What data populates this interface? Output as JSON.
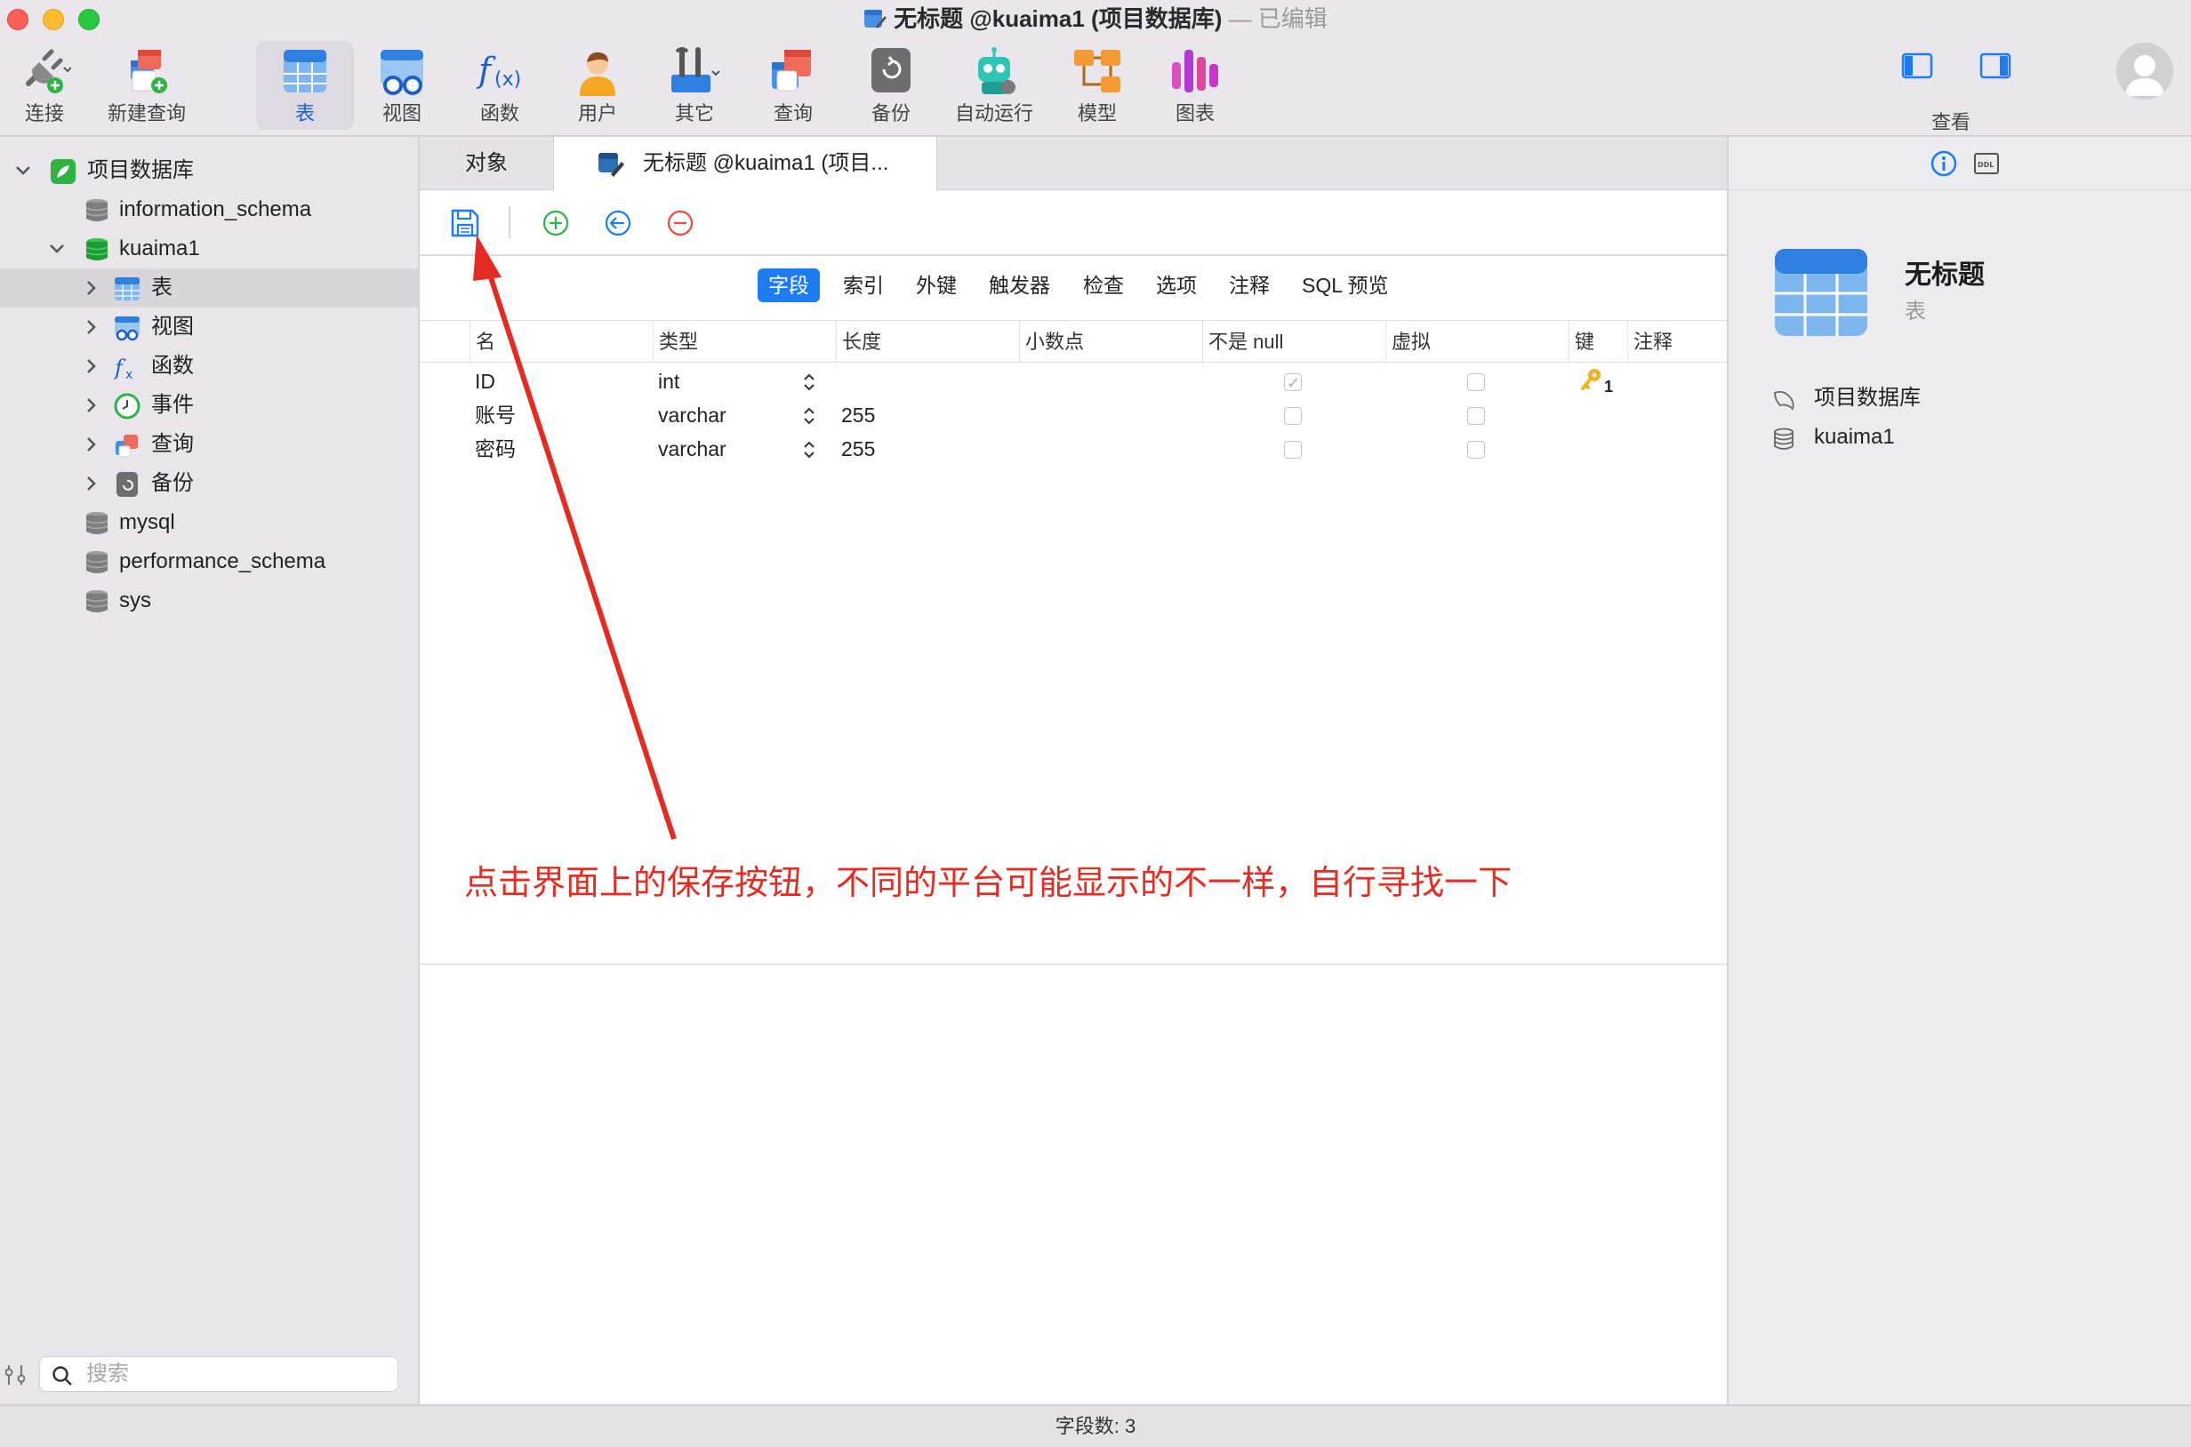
{
  "window": {
    "title": "无标题 @kuaima1 (项目数据库)",
    "edited_suffix": " — 已编辑"
  },
  "toolbar": {
    "items": [
      {
        "label": "连接",
        "icon": "plug-connect-icon"
      },
      {
        "label": "新建查询",
        "icon": "new-query-icon"
      },
      {
        "label": "表",
        "icon": "table-icon",
        "active": true
      },
      {
        "label": "视图",
        "icon": "view-glasses-icon"
      },
      {
        "label": "函数",
        "icon": "function-fx-icon"
      },
      {
        "label": "用户",
        "icon": "user-icon"
      },
      {
        "label": "其它",
        "icon": "tools-icon"
      },
      {
        "label": "查询",
        "icon": "query-icon"
      },
      {
        "label": "备份",
        "icon": "backup-icon"
      },
      {
        "label": "自动运行",
        "icon": "robot-icon"
      },
      {
        "label": "模型",
        "icon": "model-icon"
      },
      {
        "label": "图表",
        "icon": "chart-icon"
      }
    ],
    "view_label": "查看"
  },
  "sidebar": {
    "connection": "项目数据库",
    "items": [
      {
        "label": "information_schema",
        "icon": "database-icon"
      },
      {
        "label": "kuaima1",
        "icon": "database-icon"
      },
      {
        "label": "表",
        "icon": "table-icon"
      },
      {
        "label": "视图",
        "icon": "view-icon"
      },
      {
        "label": "函数",
        "icon": "function-icon"
      },
      {
        "label": "事件",
        "icon": "clock-icon"
      },
      {
        "label": "查询",
        "icon": "query-icon"
      },
      {
        "label": "备份",
        "icon": "backup-icon"
      },
      {
        "label": "mysql",
        "icon": "database-icon"
      },
      {
        "label": "performance_schema",
        "icon": "database-icon"
      },
      {
        "label": "sys",
        "icon": "database-icon"
      }
    ],
    "search_placeholder": "搜索"
  },
  "tabs": {
    "objects": "对象",
    "untitled": "无标题 @kuaima1 (项目..."
  },
  "subtabs": [
    "字段",
    "索引",
    "外键",
    "触发器",
    "检查",
    "选项",
    "注释",
    "SQL 预览"
  ],
  "grid": {
    "columns": [
      "名",
      "类型",
      "长度",
      "小数点",
      "不是 null",
      "虚拟",
      "键",
      "注释"
    ],
    "rows": [
      {
        "name": "ID",
        "type": "int",
        "length": "",
        "not_null": true,
        "virtual": false,
        "key": "1"
      },
      {
        "name": "账号",
        "type": "varchar",
        "length": "255",
        "not_null": false,
        "virtual": false,
        "key": ""
      },
      {
        "name": "密码",
        "type": "varchar",
        "length": "255",
        "not_null": false,
        "virtual": false,
        "key": ""
      }
    ]
  },
  "annotation": "点击界面上的保存按钮，不同的平台可能显示的不一样，自行寻找一下",
  "inspector": {
    "title": "无标题",
    "subtitle": "表",
    "connection": "项目数据库",
    "database": "kuaima1"
  },
  "status": {
    "field_count": "字段数: 3"
  },
  "colors": {
    "accent": "#1e7cf3",
    "annotation": "#e32d23"
  }
}
